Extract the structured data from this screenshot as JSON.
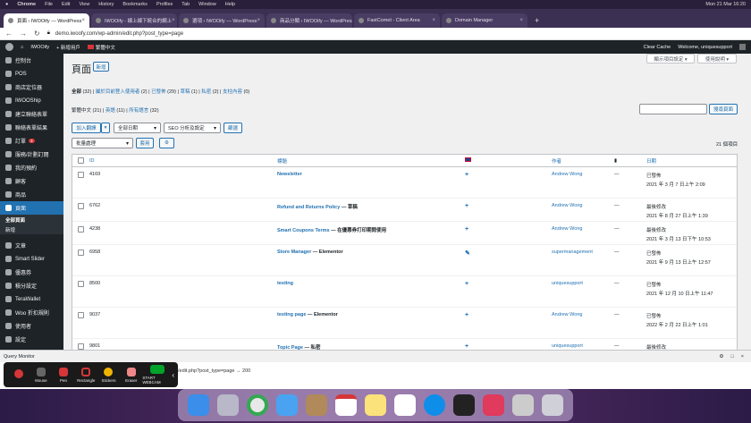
{
  "mac": {
    "apple": "",
    "app": "Chrome",
    "menus": [
      "File",
      "Edit",
      "View",
      "History",
      "Bookmarks",
      "Profiles",
      "Tab",
      "Window",
      "Help"
    ],
    "clock": "Mon 21 Mar 16:20"
  },
  "tabs": [
    {
      "label": "頁面 ‹ IWOOify — WordPress",
      "active": true
    },
    {
      "label": "IWOOify - 線上線下統合的網上",
      "active": false
    },
    {
      "label": "選項 ‹ IWOOify — WordPress",
      "active": false
    },
    {
      "label": "商品分類 ‹ IWOOify — WordPress",
      "active": false
    },
    {
      "label": "FastComet - Client Area",
      "active": false
    },
    {
      "label": "Domain Manager",
      "active": false
    }
  ],
  "url": "demo.iwoofy.com/wp-admin/edit.php?post_type=page",
  "adminbar": {
    "site": "IWOOify",
    "new": "+ 新增用戶",
    "lang": "繁體中文",
    "clear": "Clear Cache",
    "welcome": "Welcome, uniquesupport"
  },
  "sidebar": {
    "items": [
      {
        "label": "控制台"
      },
      {
        "label": "POS"
      },
      {
        "label": "商店定位器"
      },
      {
        "label": "IWOOShip"
      },
      {
        "label": "建立聯絡表單"
      },
      {
        "label": "聯絡表單結果"
      },
      {
        "label": "訂單",
        "badge": "3"
      },
      {
        "label": "服務/計劃訂閱"
      },
      {
        "label": "我的預約"
      },
      {
        "label": "顧客"
      },
      {
        "label": "商品"
      },
      {
        "label": "頁面",
        "active": true
      }
    ],
    "subs": [
      {
        "label": "全部頁面",
        "current": true
      },
      {
        "label": "新增"
      }
    ],
    "items2": [
      {
        "label": "文章"
      },
      {
        "label": "Smart Slider"
      },
      {
        "label": "優惠券"
      },
      {
        "label": "積分設定"
      },
      {
        "label": "TeraWallet"
      },
      {
        "label": "Woo 折扣規則"
      },
      {
        "label": "使用者"
      },
      {
        "label": "設定"
      }
    ]
  },
  "main": {
    "title": "頁面",
    "new_button": "新增",
    "screen_options": "顯示項目設定 ▾",
    "help": "使用說明 ▾",
    "filters": {
      "all": "全部",
      "all_n": "(32)",
      "mine": "屬於目前登入使用者",
      "mine_n": "(2)",
      "published": "已發佈",
      "published_n": "(29)",
      "draft": "草稿",
      "draft_n": "(1)",
      "private": "私密",
      "private_n": "(2)",
      "cornerstone": "支柱內容",
      "cornerstone_n": "(0)"
    },
    "langs": {
      "zh": "繁體中文",
      "zh_n": "(21)",
      "en": "英語",
      "en_n": "(11)",
      "all": "所有語言",
      "all_n": "(32)"
    },
    "search_button": "搜尋頁面",
    "add_translation": "加入翻譯",
    "all_dates": "全部日期",
    "seo": "SEO 分析及設定",
    "filter": "篩選",
    "bulk": "批量處理",
    "apply": "套用",
    "count": "21 個項目",
    "cols": {
      "id": "ID",
      "title": "標題",
      "author": "作者",
      "date": "日期"
    },
    "rows": [
      {
        "id": "4169",
        "title": "Newsletter",
        "state": "",
        "icon": "+",
        "author": "Andrew Wong",
        "comments": "—",
        "status": "已發佈",
        "date": "2021 年 3 月 7 日上午 2:09"
      },
      {
        "id": "6762",
        "title": "Refund and Returns Policy",
        "state": " — 草稿",
        "icon": "+",
        "author": "Andrew Wong",
        "comments": "—",
        "status": "最後修改",
        "date": "2021 年 8 月 27 日上午 1:39"
      },
      {
        "id": "4238",
        "title": "Smart Coupons Terms",
        "state": " — 在優惠券打印期間使用",
        "icon": "+",
        "author": "Andrew Wong",
        "comments": "—",
        "status": "最後修改",
        "date": "2021 年 3 月 13 日下午 10:53"
      },
      {
        "id": "6958",
        "title": "Store Manager",
        "state": " — Elementor",
        "icon": "✎",
        "author": "supermanagement",
        "comments": "—",
        "status": "已發佈",
        "date": "2021 年 9 月 13 日上午 12:57"
      },
      {
        "id": "8500",
        "title": "testing",
        "state": "",
        "icon": "+",
        "author": "uniquesupport",
        "comments": "—",
        "status": "已發佈",
        "date": "2021 年 12 月 10 日上午 11:47"
      },
      {
        "id": "9037",
        "title": "testing page",
        "state": " — Elementor",
        "icon": "+",
        "author": "Andrew Wong",
        "comments": "—",
        "status": "已發佈",
        "date": "2022 年 2 月 22 日上午 1:01"
      },
      {
        "id": "9801",
        "title": "Topic Page",
        "state": " — 私密",
        "icon": "+",
        "author": "uniquesupport",
        "comments": "—",
        "status": "最後修改",
        "date": ""
      }
    ]
  },
  "qm": {
    "title": "Query Monitor",
    "line": "/edit.php?post_type=page → 200"
  },
  "draw": {
    "tools": [
      "Mouse",
      "Pen",
      "Rectangle",
      "Stickers",
      "Eraser",
      "START WEBCAM"
    ]
  },
  "colors": {
    "accent": "#2271b1",
    "adminbar": "#1d2327"
  }
}
